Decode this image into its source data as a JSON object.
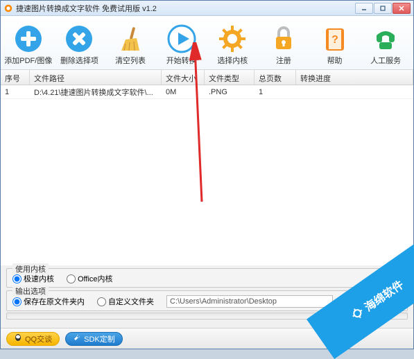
{
  "titlebar": {
    "title": "捷速图片转换成文字软件 免费试用版 v1.2"
  },
  "toolbar": {
    "add": "添加PDF/图像",
    "remove": "删除选择项",
    "clear": "清空列表",
    "start": "开始转换",
    "engine": "选择内核",
    "register": "注册",
    "help": "帮助",
    "service": "人工服务"
  },
  "table": {
    "headers": {
      "seq": "序号",
      "path": "文件路径",
      "size": "文件大小",
      "type": "文件类型",
      "pages": "总页数",
      "progress": "转换进度"
    },
    "rows": [
      {
        "seq": "1",
        "path": "D:\\4.21\\捷速图片转换成文字软件\\...",
        "size": "0M",
        "type": ".PNG",
        "pages": "1",
        "progress": ""
      }
    ]
  },
  "engine_group": {
    "legend": "使用内核",
    "fast": "极速内核",
    "office": "Office内核"
  },
  "output_group": {
    "legend": "输出选项",
    "same_folder": "保存在原文件夹内",
    "custom_folder": "自定义文件夹",
    "path": "C:\\Users\\Administrator\\Desktop"
  },
  "bottom": {
    "qq": "QQ交谈",
    "sdk": "SDK定制"
  },
  "banner": "海绵软件"
}
